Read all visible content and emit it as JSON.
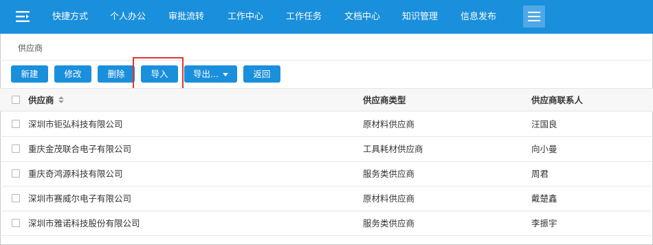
{
  "nav": {
    "logo_icon": "menu-lines-icon",
    "items": [
      "快捷方式",
      "个人办公",
      "审批流转",
      "工作中心",
      "工作任务",
      "文档中心",
      "知识管理",
      "信息发布"
    ],
    "menu_icon": "hamburger-icon",
    "bg_color": "#1a8fdc"
  },
  "breadcrumb": "供应商",
  "toolbar": {
    "new": "新建",
    "edit": "修改",
    "delete": "删除",
    "import": "导入",
    "export": "导出...",
    "back": "返回"
  },
  "table": {
    "columns": [
      "供应商",
      "供应商类型",
      "供应商联系人"
    ],
    "rows": [
      [
        "深圳市钜弘科技有限公司",
        "原材料供应商",
        "汪国良"
      ],
      [
        "重庆金茂联合电子有限公司",
        "工具耗材供应商",
        "向小曼"
      ],
      [
        "重庆奇鸿源科技有限公司",
        "服务类供应商",
        "周君"
      ],
      [
        "深圳市赛威尔电子有限公司",
        "原材料供应商",
        "戴楚鑫"
      ],
      [
        "深圳市雅诺科技股份有限公司",
        "服务类供应商",
        "李振宇"
      ]
    ]
  },
  "colors": {
    "accent": "#1a8fdc",
    "highlight": "#e3342f"
  }
}
